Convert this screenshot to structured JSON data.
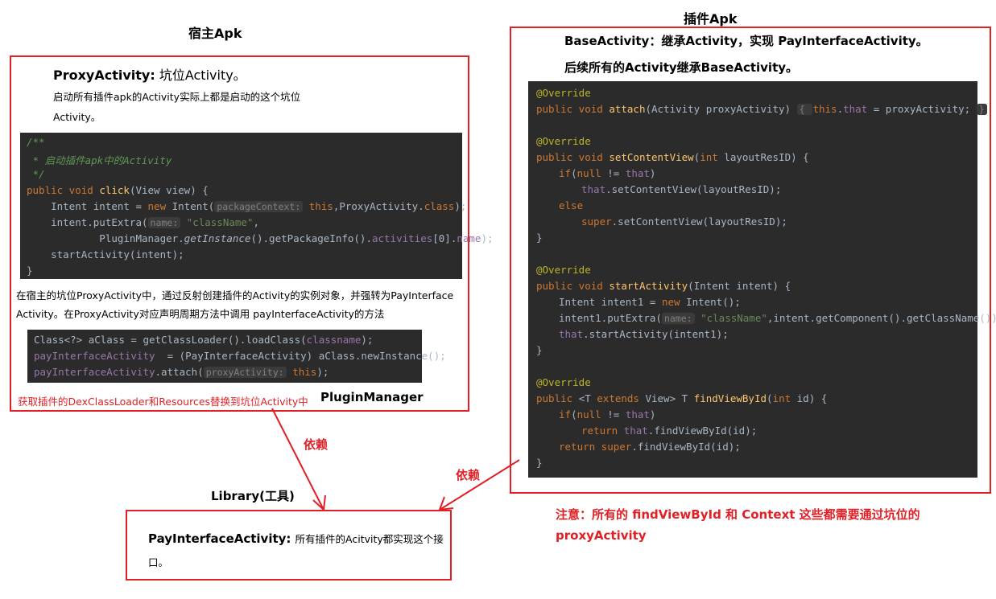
{
  "host": {
    "title": "宿主Apk",
    "proxy_heading": "ProxyActivity:",
    "proxy_heading_rest": "坑位Activity。",
    "proxy_desc_1": "启动所有插件apk的Activity实际上都是启动的这个坑位",
    "proxy_desc_2": "Activity。",
    "code1": {
      "l1": "/**",
      "l2": " * 启动插件apk中的Activity",
      "l3": " */",
      "l4_kw": "public void ",
      "l4_fn": "click",
      "l4_rest": "(View view) {",
      "l5_a": "    Intent intent = ",
      "l5_kw": "new",
      "l5_b": " Intent(",
      "l5_hint": "packageContext:",
      "l5_kw2": " this",
      "l5_c": ",ProxyActivity.",
      "l5_kw3": "class",
      "l5_d": ");",
      "l6_a": "    intent.putExtra(",
      "l6_hint": "name:",
      "l6_str": " \"className\"",
      "l6_b": ",",
      "l7_a": "            PluginManager.",
      "l7_it": "getInstance",
      "l7_b": "().getPackageInfo().",
      "l7_fld": "activities",
      "l7_c": "[0].",
      "l7_fld2": "name",
      "l7_d": ");",
      "l8": "    startActivity(intent);",
      "l9": "}"
    },
    "desc2_line1": "在宿主的坑位ProxyActivity中，通过反射创建插件的Activity的实例对象，并强转为PayInterface",
    "desc2_line2": "Activity。在ProxyActivity对应声明周期方法中调用 payInterfaceActivity的方法",
    "code2": {
      "l1_a": "Class<?> aClass = getClassLoader().loadClass(",
      "l1_fld": "classname",
      "l1_b": ");",
      "l2_fld": "payInterfaceActivity",
      "l2_a": "  = (PayInterfaceActivity) aClass.newInstance();",
      "l3_fld": "payInterfaceActivity",
      "l3_a": ".attach(",
      "l3_hint": "proxyActivity:",
      "l3_kw": " this",
      "l3_b": ");"
    },
    "note_red": "获取插件的DexClassLoader和Resources替换到坑位Activity中",
    "plugin_manager": "PluginManager"
  },
  "plugin": {
    "title": "插件Apk",
    "line1": "BaseActivity：继承Activity，实现 PayInterfaceActivity。",
    "line2": "后续所有的Activity继承BaseActivity。",
    "code": {
      "ov": "@Override",
      "a1_kw": "public void ",
      "a1_fn": "attach",
      "a1_rest": "(Activity proxyActivity) ",
      "a1_brace": "{ ",
      "a1_kw2": "this",
      "a1_dot": ".",
      "a1_fld": "that",
      "a1_end": " = proxyActivity; ",
      "a1_close": "}",
      "s1_kw": "public void ",
      "s1_fn": "setContentView",
      "s1_kw2": "int",
      "s1_rest": " layoutResID) {",
      "s1_open": "(",
      "if_kw": "if",
      "if_a": "(",
      "if_kw2": "null",
      "if_b": " != ",
      "if_fld": "that",
      "if_c": ")",
      "s2_fld": "that",
      "s2_a": ".setContentView(layoutResID);",
      "else_kw": "else",
      "s3_kw": "super",
      "s3_a": ".setContentView(layoutResID);",
      "close": "}",
      "st_kw": "public void ",
      "st_fn": "startActivity",
      "st_rest": "(Intent intent) {",
      "st1_a": "Intent intent1 = ",
      "st1_kw": "new",
      "st1_b": " Intent();",
      "st2_a": "intent1.putExtra(",
      "st2_hint": "name:",
      "st2_str": " \"className\"",
      "st2_b": ",intent.getComponent().getClassName());",
      "st3_fld": "that",
      "st3_a": ".startActivity(intent1);",
      "fv_kw": "public ",
      "fv_t": "<T ",
      "fv_kw2": "extends",
      "fv_mid": " View> ",
      "fv_t2": "T ",
      "fv_fn": "findViewById",
      "fv_open": "(",
      "fv_kw3": "int",
      "fv_rest": " id) {",
      "fv1_a": "return ",
      "fv1_fld": "that",
      "fv1_b": ".findViewById(id);",
      "fv2_kw": "return super",
      "fv2_a": ".findViewById(id);"
    }
  },
  "library": {
    "title": "Library(工具)",
    "heading": "PayInterfaceActivity:",
    "desc_1": "所有插件的Acitvity都实现这个接",
    "desc_2": "口。"
  },
  "arrows": {
    "dep1": "依赖",
    "dep2": "依赖"
  },
  "note": {
    "line1": "注意：所有的 findViewById 和 Context 这些都需要通过坑位的",
    "line2": "proxyActivity"
  },
  "colors": {
    "border_red": "#e11f25",
    "code_bg": "#2b2b2b",
    "keyword": "#cc7832",
    "annotation": "#bbb529",
    "string": "#6a8759",
    "field": "#9876aa",
    "method": "#ffc66d"
  }
}
